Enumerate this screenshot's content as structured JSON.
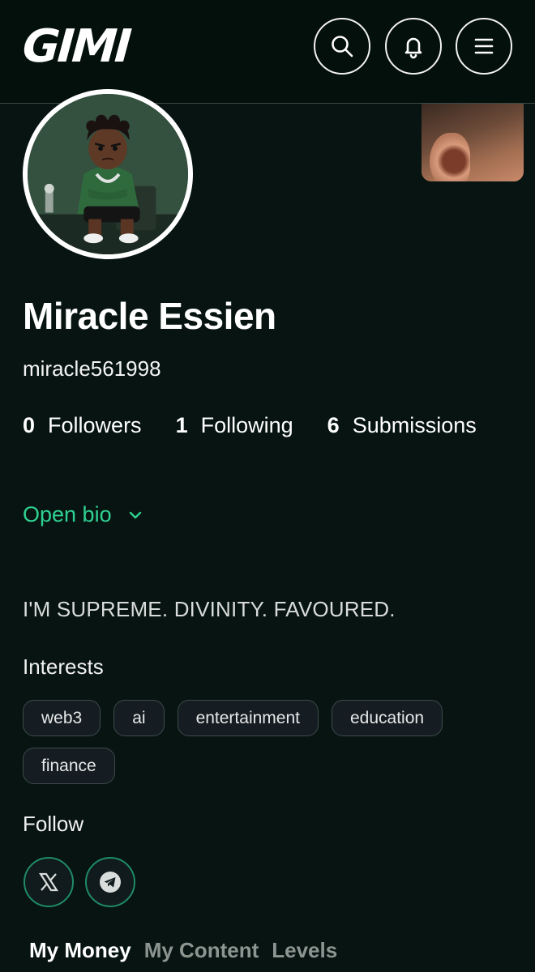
{
  "header": {
    "logo": "GIMI",
    "icons": [
      "search-icon",
      "bell-icon",
      "menu-icon"
    ]
  },
  "profile": {
    "name": "Miracle Essien",
    "handle": "miracle561998",
    "stats": [
      {
        "count": "0",
        "label": "Followers"
      },
      {
        "count": "1",
        "label": "Following"
      },
      {
        "count": "6",
        "label": "Submissions"
      }
    ],
    "open_bio_label": "Open bio",
    "bio": "I'M SUPREME. DIVINITY. FAVOURED."
  },
  "interests": {
    "title": "Interests",
    "items": [
      "web3",
      "ai",
      "entertainment",
      "education",
      "finance"
    ]
  },
  "follow": {
    "title": "Follow",
    "links": [
      "x-icon",
      "telegram-icon"
    ]
  },
  "tabs": [
    "My Money",
    "My Content",
    "Levels"
  ],
  "active_tab": "My Money",
  "colors": {
    "background": "#071411",
    "accent": "#2fd192",
    "chip_bg": "#151d22",
    "social_border": "#1f8b66"
  }
}
